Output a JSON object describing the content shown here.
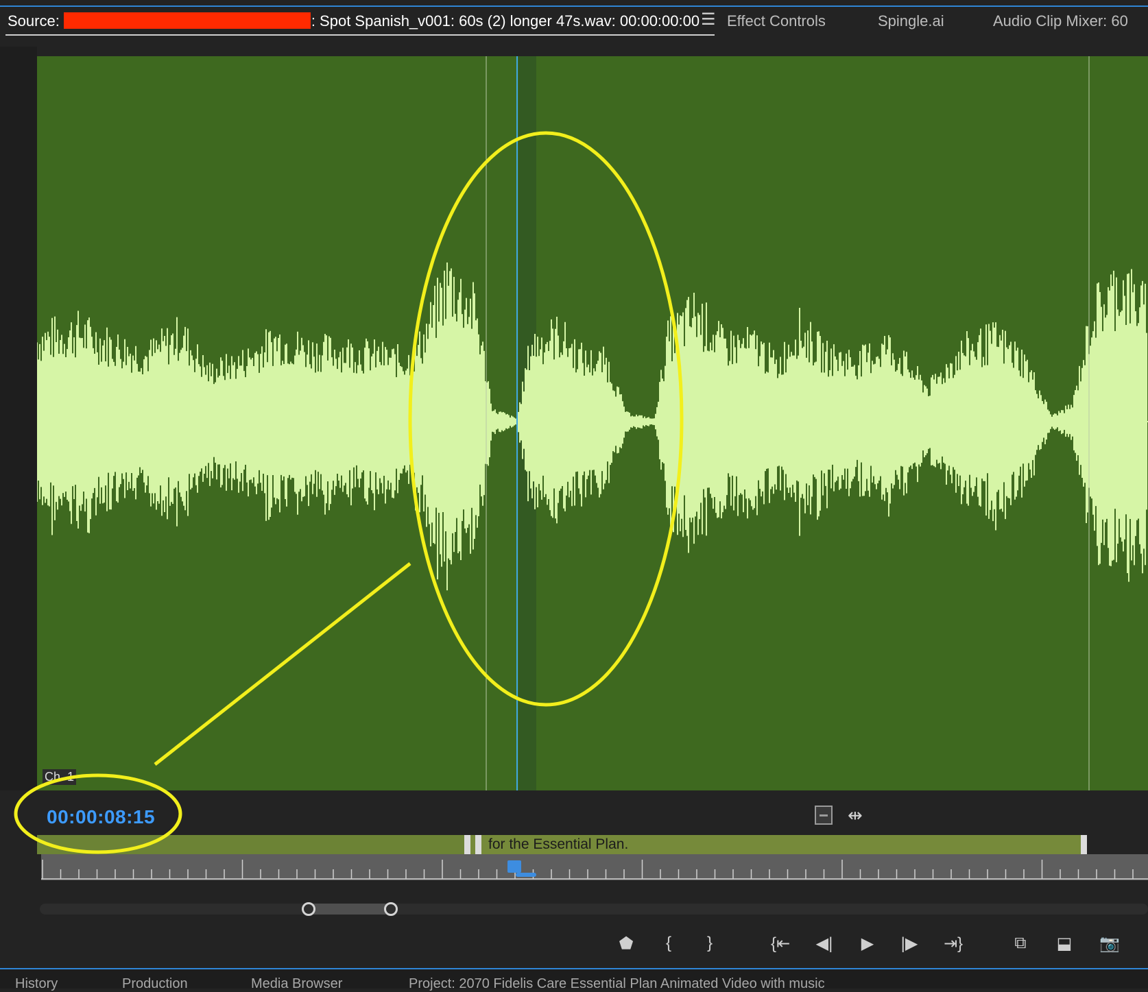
{
  "source_panel": {
    "label": "Source:",
    "clip_name": ": Spot Spanish_v001: 60s (2) longer 47s.wav: 00:00:00:00",
    "menu_icon": "hamburger-menu-icon"
  },
  "tabs": {
    "effect_controls": "Effect Controls",
    "spingle": "Spingle.ai",
    "audio_clip_mixer": "Audio Clip Mixer: 60"
  },
  "waveform": {
    "channel_label": "Ch. 1",
    "colors": {
      "background": "#3e691f",
      "wave": "#d6f5a6",
      "playhead": "#3fa6e0"
    }
  },
  "playback": {
    "timecode": "00:00:08:15"
  },
  "clip_bar": {
    "caption": "for the Essential Plan."
  },
  "transport_controls": [
    {
      "name": "add-marker-icon",
      "glyph": "⬟"
    },
    {
      "name": "mark-in-icon",
      "glyph": "{"
    },
    {
      "name": "mark-out-icon",
      "glyph": "}"
    },
    {
      "name": "go-to-in-icon",
      "glyph": "{⇤"
    },
    {
      "name": "step-back-icon",
      "glyph": "◀|"
    },
    {
      "name": "play-icon",
      "glyph": "▶"
    },
    {
      "name": "step-forward-icon",
      "glyph": "|▶"
    },
    {
      "name": "go-to-out-icon",
      "glyph": "⇥}"
    },
    {
      "name": "insert-icon",
      "glyph": "⧉"
    },
    {
      "name": "overwrite-icon",
      "glyph": "⬓"
    },
    {
      "name": "export-frame-icon",
      "glyph": "📷"
    }
  ],
  "bottom_tabs": {
    "history": "History",
    "production": "Production",
    "media_browser": "Media Browser",
    "project": "Project: 2070 Fidelis Care Essential Plan Animated Video with music"
  }
}
